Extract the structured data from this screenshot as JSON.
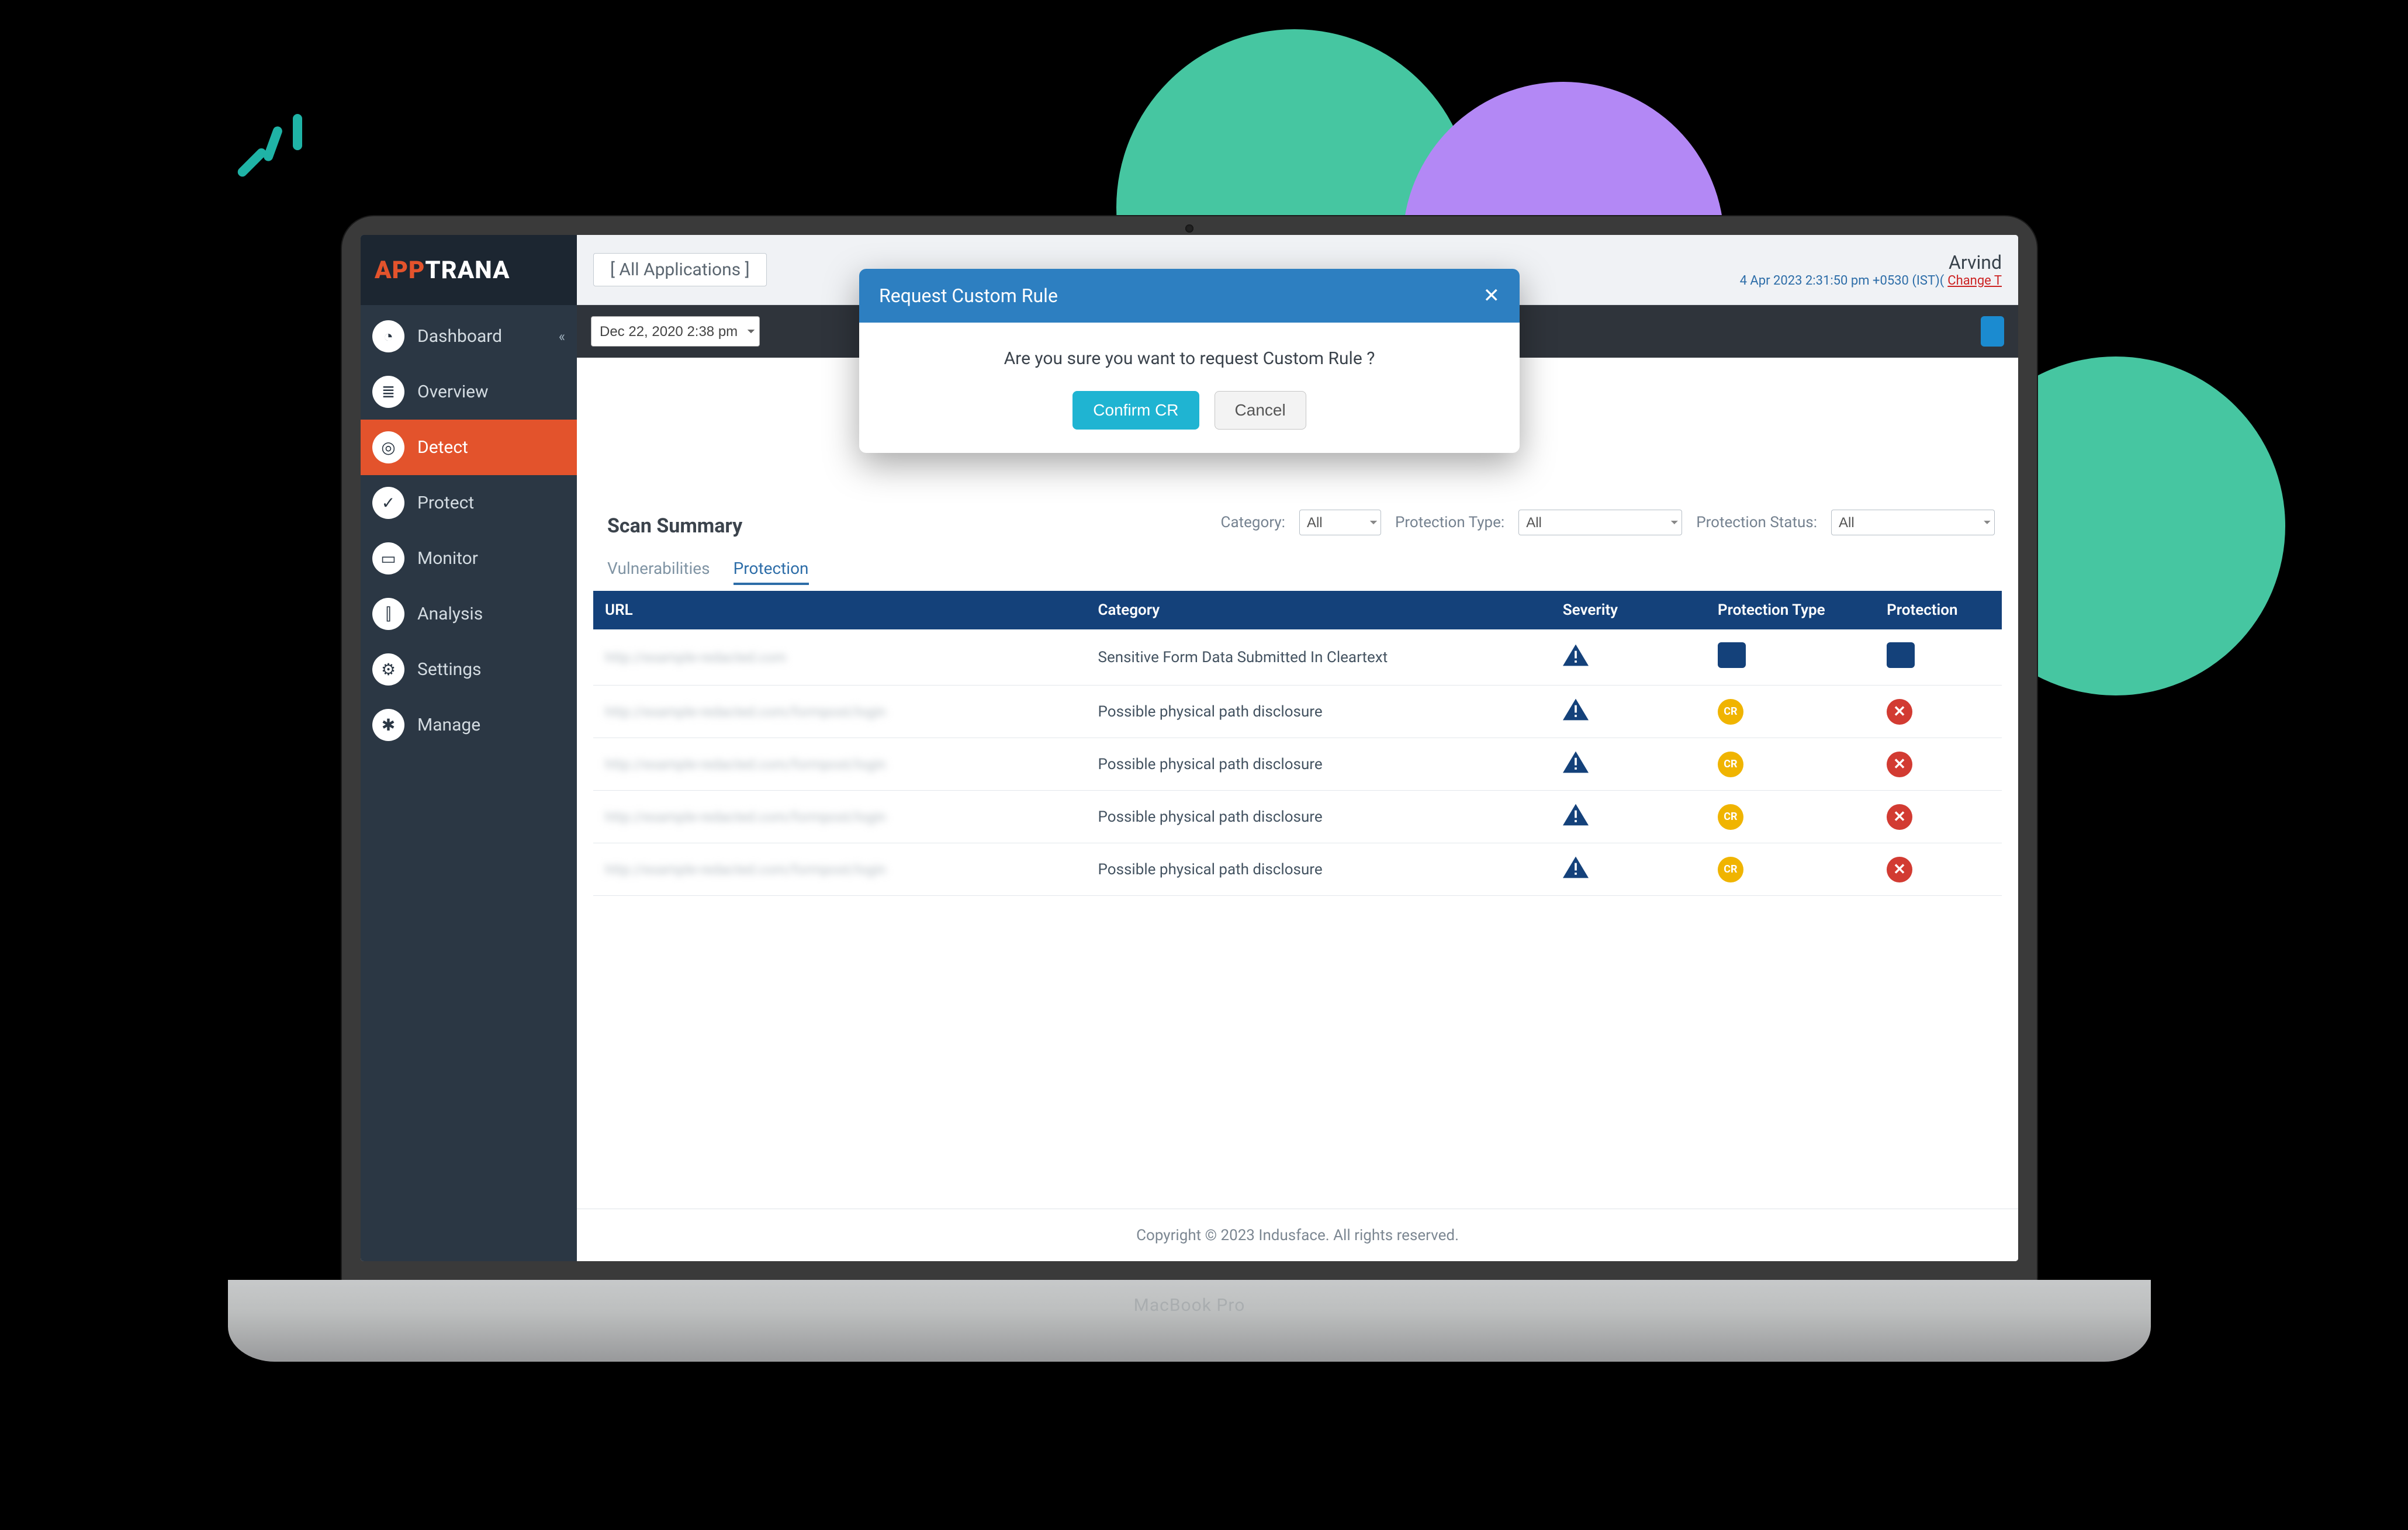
{
  "brand": {
    "left": "APP",
    "right": "TRANA"
  },
  "hinge_label": "MacBook Pro",
  "sidebar": {
    "items": [
      {
        "label": "Dashboard",
        "icon": "dashboard"
      },
      {
        "label": "Overview",
        "icon": "overview"
      },
      {
        "label": "Detect",
        "icon": "target"
      },
      {
        "label": "Protect",
        "icon": "shield"
      },
      {
        "label": "Monitor",
        "icon": "monitor"
      },
      {
        "label": "Analysis",
        "icon": "chart"
      },
      {
        "label": "Settings",
        "icon": "gears"
      },
      {
        "label": "Manage",
        "icon": "gear"
      }
    ],
    "active_index": 2
  },
  "topbar": {
    "all_apps_label": "[ All Applications ]",
    "user_name": "Arvind",
    "timestamp": "4 Apr 2023 2:31:50 pm +0530 (IST)",
    "change_tz": "Change T"
  },
  "toolbar": {
    "date_selected": "Dec 22, 2020 2:38 pm"
  },
  "scan": {
    "title": "Scan Summary",
    "filters": {
      "category_label": "Category:",
      "protection_type_label": "Protection Type:",
      "protection_status_label": "Protection Status:",
      "all": "All"
    },
    "tabs": {
      "vuln": "Vulnerabilities",
      "prot": "Protection"
    },
    "columns": {
      "url": "URL",
      "category": "Category",
      "severity": "Severity",
      "ptype": "Protection Type",
      "pstatus": "Protection"
    },
    "rows": [
      {
        "url": "http://example-redacted.com",
        "category": "Sensitive Form Data Submitted In Cleartext",
        "severity": "medium",
        "ptype": "code",
        "pstatus": "code"
      },
      {
        "url": "http://example-redacted.com/formpost/login",
        "category": "Possible physical path disclosure",
        "severity": "medium",
        "ptype": "cr",
        "pstatus": "fail"
      },
      {
        "url": "http://example-redacted.com/formpost/login",
        "category": "Possible physical path disclosure",
        "severity": "medium",
        "ptype": "cr",
        "pstatus": "fail"
      },
      {
        "url": "http://example-redacted.com/formpost/login",
        "category": "Possible physical path disclosure",
        "severity": "medium",
        "ptype": "cr",
        "pstatus": "fail"
      },
      {
        "url": "http://example-redacted.com/formpost/login",
        "category": "Possible physical path disclosure",
        "severity": "medium",
        "ptype": "cr",
        "pstatus": "fail"
      }
    ]
  },
  "footer": {
    "copyright": "Copyright © 2023 Indusface. All rights reserved."
  },
  "modal": {
    "title": "Request Custom Rule",
    "message": "Are you sure you want to request Custom Rule ?",
    "confirm": "Confirm CR",
    "cancel": "Cancel"
  },
  "badges": {
    "cr": "CR",
    "code": "</>",
    "x": "✕"
  }
}
